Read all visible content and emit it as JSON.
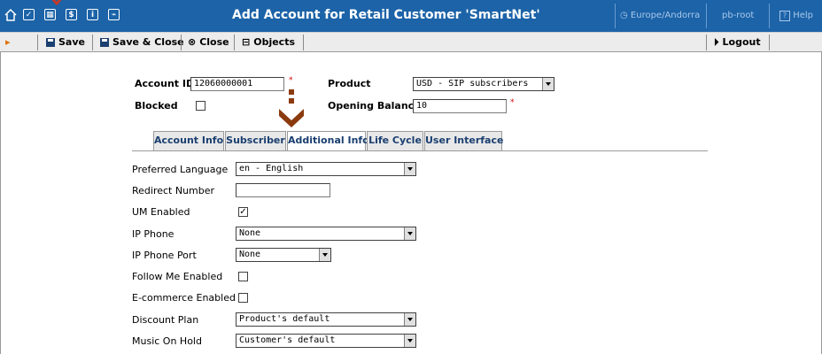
{
  "window": {
    "title": "Add Account for Retail Customer 'SmartNet'",
    "timezone": "Europe/Andorra",
    "user": "pb-root",
    "help": "Help"
  },
  "toolbar": {
    "save": "Save",
    "save_close": "Save & Close",
    "close": "Close",
    "objects": "Objects",
    "logout": "Logout"
  },
  "form": {
    "account_id_label": "Account ID",
    "account_id_value": "12060000001",
    "product_label": "Product",
    "product_value": "USD - SIP subscribers",
    "blocked_label": "Blocked",
    "opening_balance_label": "Opening Balance",
    "opening_balance_value": "10",
    "required_mark": "*"
  },
  "tabs": [
    {
      "label": "Account Info",
      "active": false
    },
    {
      "label": "Subscriber",
      "active": false
    },
    {
      "label": "Additional Info",
      "active": true
    },
    {
      "label": "Life Cycle",
      "active": false
    },
    {
      "label": "User Interface",
      "active": false
    }
  ],
  "additional": {
    "preferred_language_label": "Preferred Language",
    "preferred_language_value": "en - English",
    "redirect_number_label": "Redirect Number",
    "redirect_number_value": "",
    "um_enabled_label": "UM Enabled",
    "um_enabled_checked": true,
    "ip_phone_label": "IP Phone",
    "ip_phone_value": "None",
    "ip_phone_port_label": "IP Phone Port",
    "ip_phone_port_value": "None",
    "follow_me_label": "Follow Me Enabled",
    "follow_me_checked": false,
    "ecommerce_label": "E-commerce Enabled",
    "ecommerce_checked": false,
    "discount_plan_label": "Discount Plan",
    "discount_plan_value": "Product's default",
    "music_on_hold_label": "Music On Hold",
    "music_on_hold_value": "Customer's default"
  },
  "colors": {
    "titlebar": "#1c63a8",
    "tab_text": "#1a3f70",
    "indicator": "#8b3a0e",
    "required": "#d40000"
  }
}
